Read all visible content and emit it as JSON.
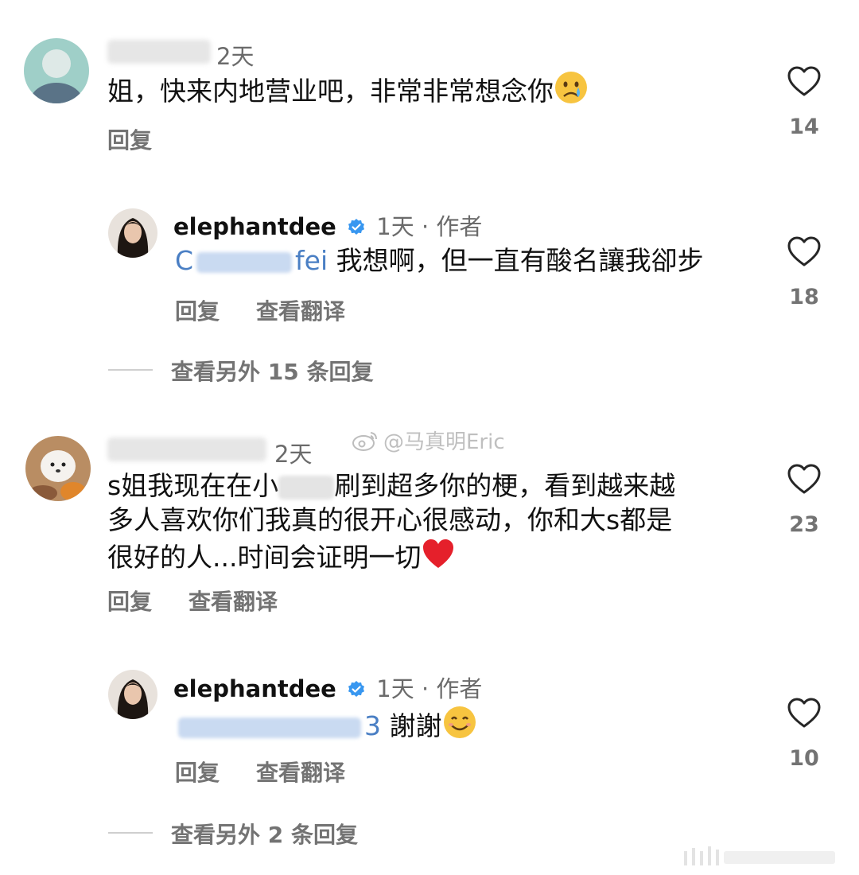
{
  "comments": [
    {
      "time": "2天",
      "text_before": "姐，快来内地营业吧，非常非常想念你",
      "reply_label": "回复",
      "likes": "14",
      "replies": [
        {
          "author": "elephantdee",
          "time": "1天",
          "separator": "·",
          "author_badge": "作者",
          "mention_visible": "fei",
          "text": "我想啊，但一直有酸名讓我卻步",
          "reply_label": "回复",
          "translate_label": "查看翻译",
          "likes": "18"
        }
      ],
      "more_replies": "查看另外 15 条回复"
    },
    {
      "time": "2天",
      "text_line1_a": "s姐我现在在小",
      "text_line1_b": "刷到超多你的梗，看到越来越",
      "text_line2": "多人喜欢你们我真的很开心很感动，你和大s都是",
      "text_line3": "很好的人...时间会证明一切",
      "reply_label": "回复",
      "translate_label": "查看翻译",
      "likes": "23",
      "replies": [
        {
          "author": "elephantdee",
          "time": "1天",
          "separator": "·",
          "author_badge": "作者",
          "mention_visible": "3",
          "text": "謝謝",
          "reply_label": "回复",
          "translate_label": "查看翻译",
          "likes": "10"
        }
      ],
      "more_replies": "查看另外 2 条回复"
    }
  ],
  "watermark": "@马真明Eric",
  "icons": {
    "like": "heart-outline-icon",
    "verified": "verified-badge-icon",
    "crying": "crying-face-emoji",
    "heart": "red-heart-emoji",
    "smile": "smiling-face-emoji"
  },
  "colors": {
    "mention": "#4a7fc4",
    "verified": "#3897f0",
    "secondary": "#737373"
  }
}
